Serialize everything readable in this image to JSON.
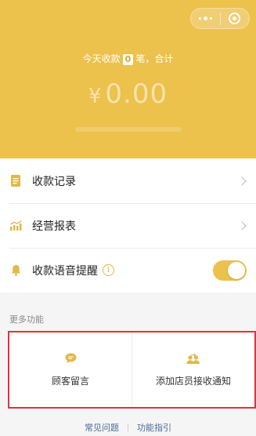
{
  "header": {
    "capsule": {
      "menu_icon": "more-dots-icon",
      "close_icon": "target-icon"
    },
    "summary_prefix": "今天收款",
    "count": "0",
    "summary_suffix": "笔，合计",
    "currency": "¥",
    "amount": "0.00"
  },
  "menu": {
    "items": [
      {
        "label": "收款记录",
        "icon": "document-icon"
      },
      {
        "label": "经营报表",
        "icon": "chart-icon"
      },
      {
        "label": "收款语音提醒",
        "icon": "bell-icon",
        "info": "i",
        "toggle_on": true
      }
    ]
  },
  "more": {
    "title": "更多功能",
    "items": [
      {
        "label": "顾客留言",
        "icon": "message-icon"
      },
      {
        "label": "添加店员接收通知",
        "icon": "add-staff-icon"
      }
    ]
  },
  "footer": {
    "faq": "常见问题",
    "guide": "功能指引"
  },
  "colors": {
    "accent": "#ecc14c",
    "highlight_border": "#e0323c",
    "link": "#4a6a9c"
  }
}
